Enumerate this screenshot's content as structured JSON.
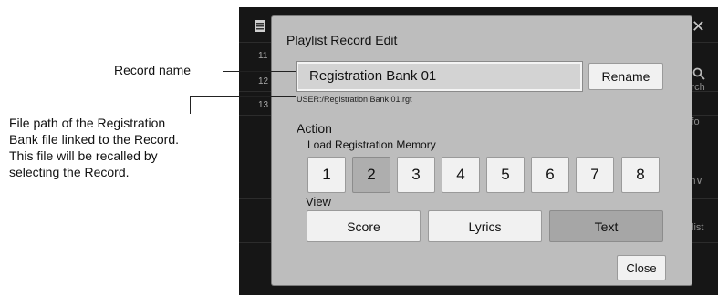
{
  "background": {
    "row_numbers": [
      "11",
      "12",
      "13"
    ],
    "side_labels": [
      "arch",
      "fo",
      "m∨",
      "ylist"
    ],
    "close_glyph": "✕",
    "icons": [
      "playlist-icon",
      "search-icon",
      "close-icon"
    ]
  },
  "dialog": {
    "title": "Playlist Record Edit",
    "record_name": "Registration Bank 01",
    "rename_label": "Rename",
    "file_path": "USER:/Registration Bank 01.rgt",
    "action_label": "Action",
    "load_memory_label": "Load Registration Memory",
    "memory_buttons": [
      "1",
      "2",
      "3",
      "4",
      "5",
      "6",
      "7",
      "8"
    ],
    "memory_selected": "2",
    "view_label": "View",
    "view_buttons": [
      "Score",
      "Lyrics",
      "Text"
    ],
    "view_selected": "Text",
    "close_label": "Close"
  },
  "callouts": {
    "record_name": "Record name",
    "file_path_line1": "File path of the Registration",
    "file_path_line2": "Bank file linked to the Record.",
    "file_path_line3": "This file will be recalled by",
    "file_path_line4": "selecting the Record."
  },
  "colors": {
    "dialog_bg": "#bdbdbd",
    "button_bg": "#f1f1f1",
    "selected_button_bg": "#aeaeae",
    "screen_bg": "#161616"
  }
}
